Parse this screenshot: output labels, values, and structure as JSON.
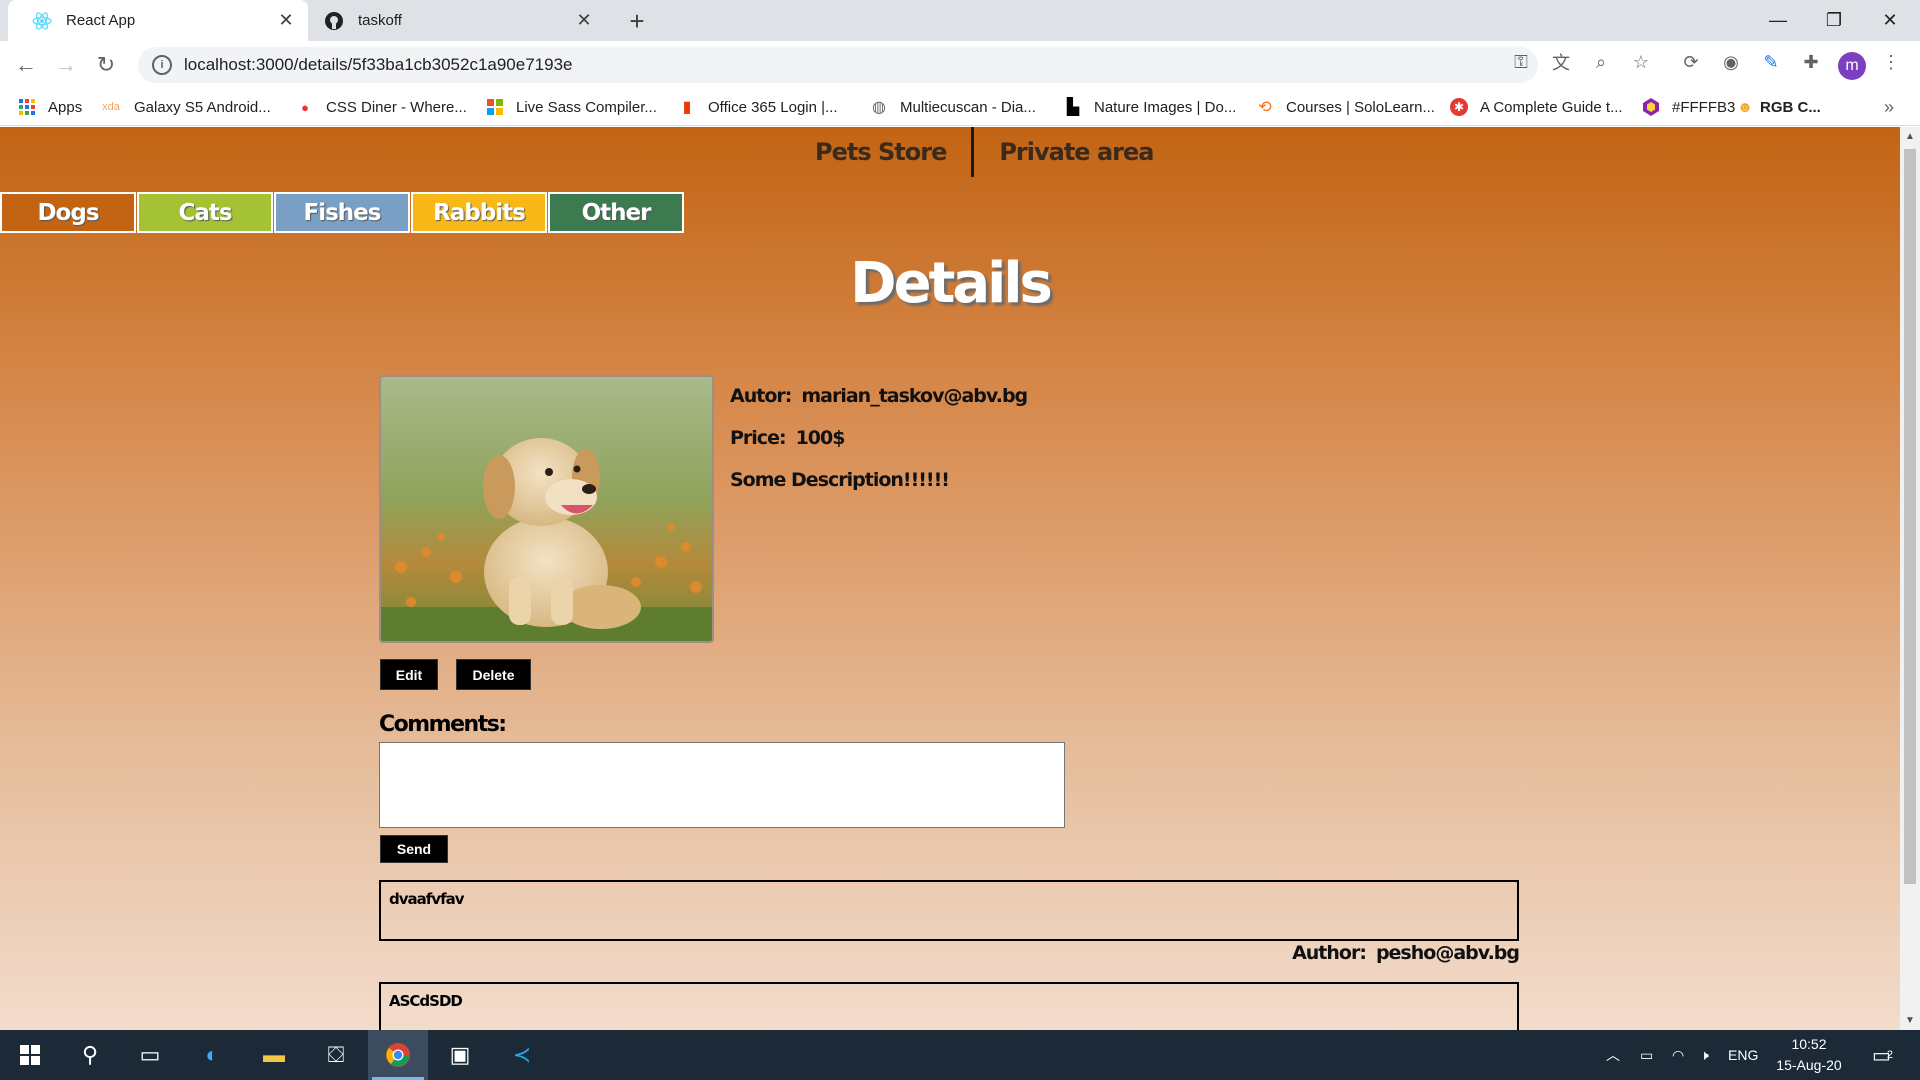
{
  "browser": {
    "tabs": [
      {
        "title": "React App",
        "icon": "react-icon",
        "active": true
      },
      {
        "title": "taskoff",
        "icon": "github-icon",
        "active": false
      }
    ],
    "url": "localhost:3000/details/5f33ba1cb3052c1a90e7193e",
    "profile_initial": "m",
    "bookmarks": [
      {
        "label": "Apps",
        "icon": "apps-grid-icon"
      },
      {
        "label": "Galaxy S5 Android...",
        "icon": "xda-icon"
      },
      {
        "label": "CSS Diner - Where...",
        "icon": "css-diner-icon"
      },
      {
        "label": "Live Sass Compiler...",
        "icon": "windows-logo-icon"
      },
      {
        "label": "Office 365 Login |...",
        "icon": "office-icon"
      },
      {
        "label": "Multiecuscan - Dia...",
        "icon": "globe-icon"
      },
      {
        "label": "Nature Images | Do...",
        "icon": "unsplash-icon"
      },
      {
        "label": "Courses | SoloLearn...",
        "icon": "sololearn-icon"
      },
      {
        "label": "A Complete Guide t...",
        "icon": "css-tricks-icon"
      },
      {
        "label": "#FFFFB3",
        "icon": "color-hex-icon"
      },
      {
        "label": "RGB C...",
        "icon": "rgb-icon"
      }
    ]
  },
  "site": {
    "nav": {
      "store": "Pets Store",
      "private": "Private area"
    },
    "categories": [
      {
        "label": "Dogs",
        "color": "#c26414"
      },
      {
        "label": "Cats",
        "color": "#a4c234"
      },
      {
        "label": "Fishes",
        "color": "#7a9fc4"
      },
      {
        "label": "Rabbits",
        "color": "#f7b818"
      },
      {
        "label": "Other",
        "color": "#3c7a50"
      }
    ],
    "title": "Details"
  },
  "pet": {
    "author_label": "Autor:",
    "author": "marian_taskov@abv.bg",
    "price_label": "Price:",
    "price": "100$",
    "description": "Some Description!!!!!!",
    "image": "golden-retriever-puppy-photo"
  },
  "actions": {
    "edit": "Edit",
    "delete": "Delete"
  },
  "comments": {
    "label": "Comments:",
    "input_value": "",
    "send": "Send",
    "author_label": "Author:",
    "items": [
      {
        "text": "dvaafvfav",
        "author": "pesho@abv.bg"
      },
      {
        "text": "ASCdSDD",
        "author": ""
      }
    ]
  },
  "taskbar": {
    "language": "ENG",
    "time": "10:52",
    "date": "15-Aug-20",
    "notification_count": "2"
  }
}
